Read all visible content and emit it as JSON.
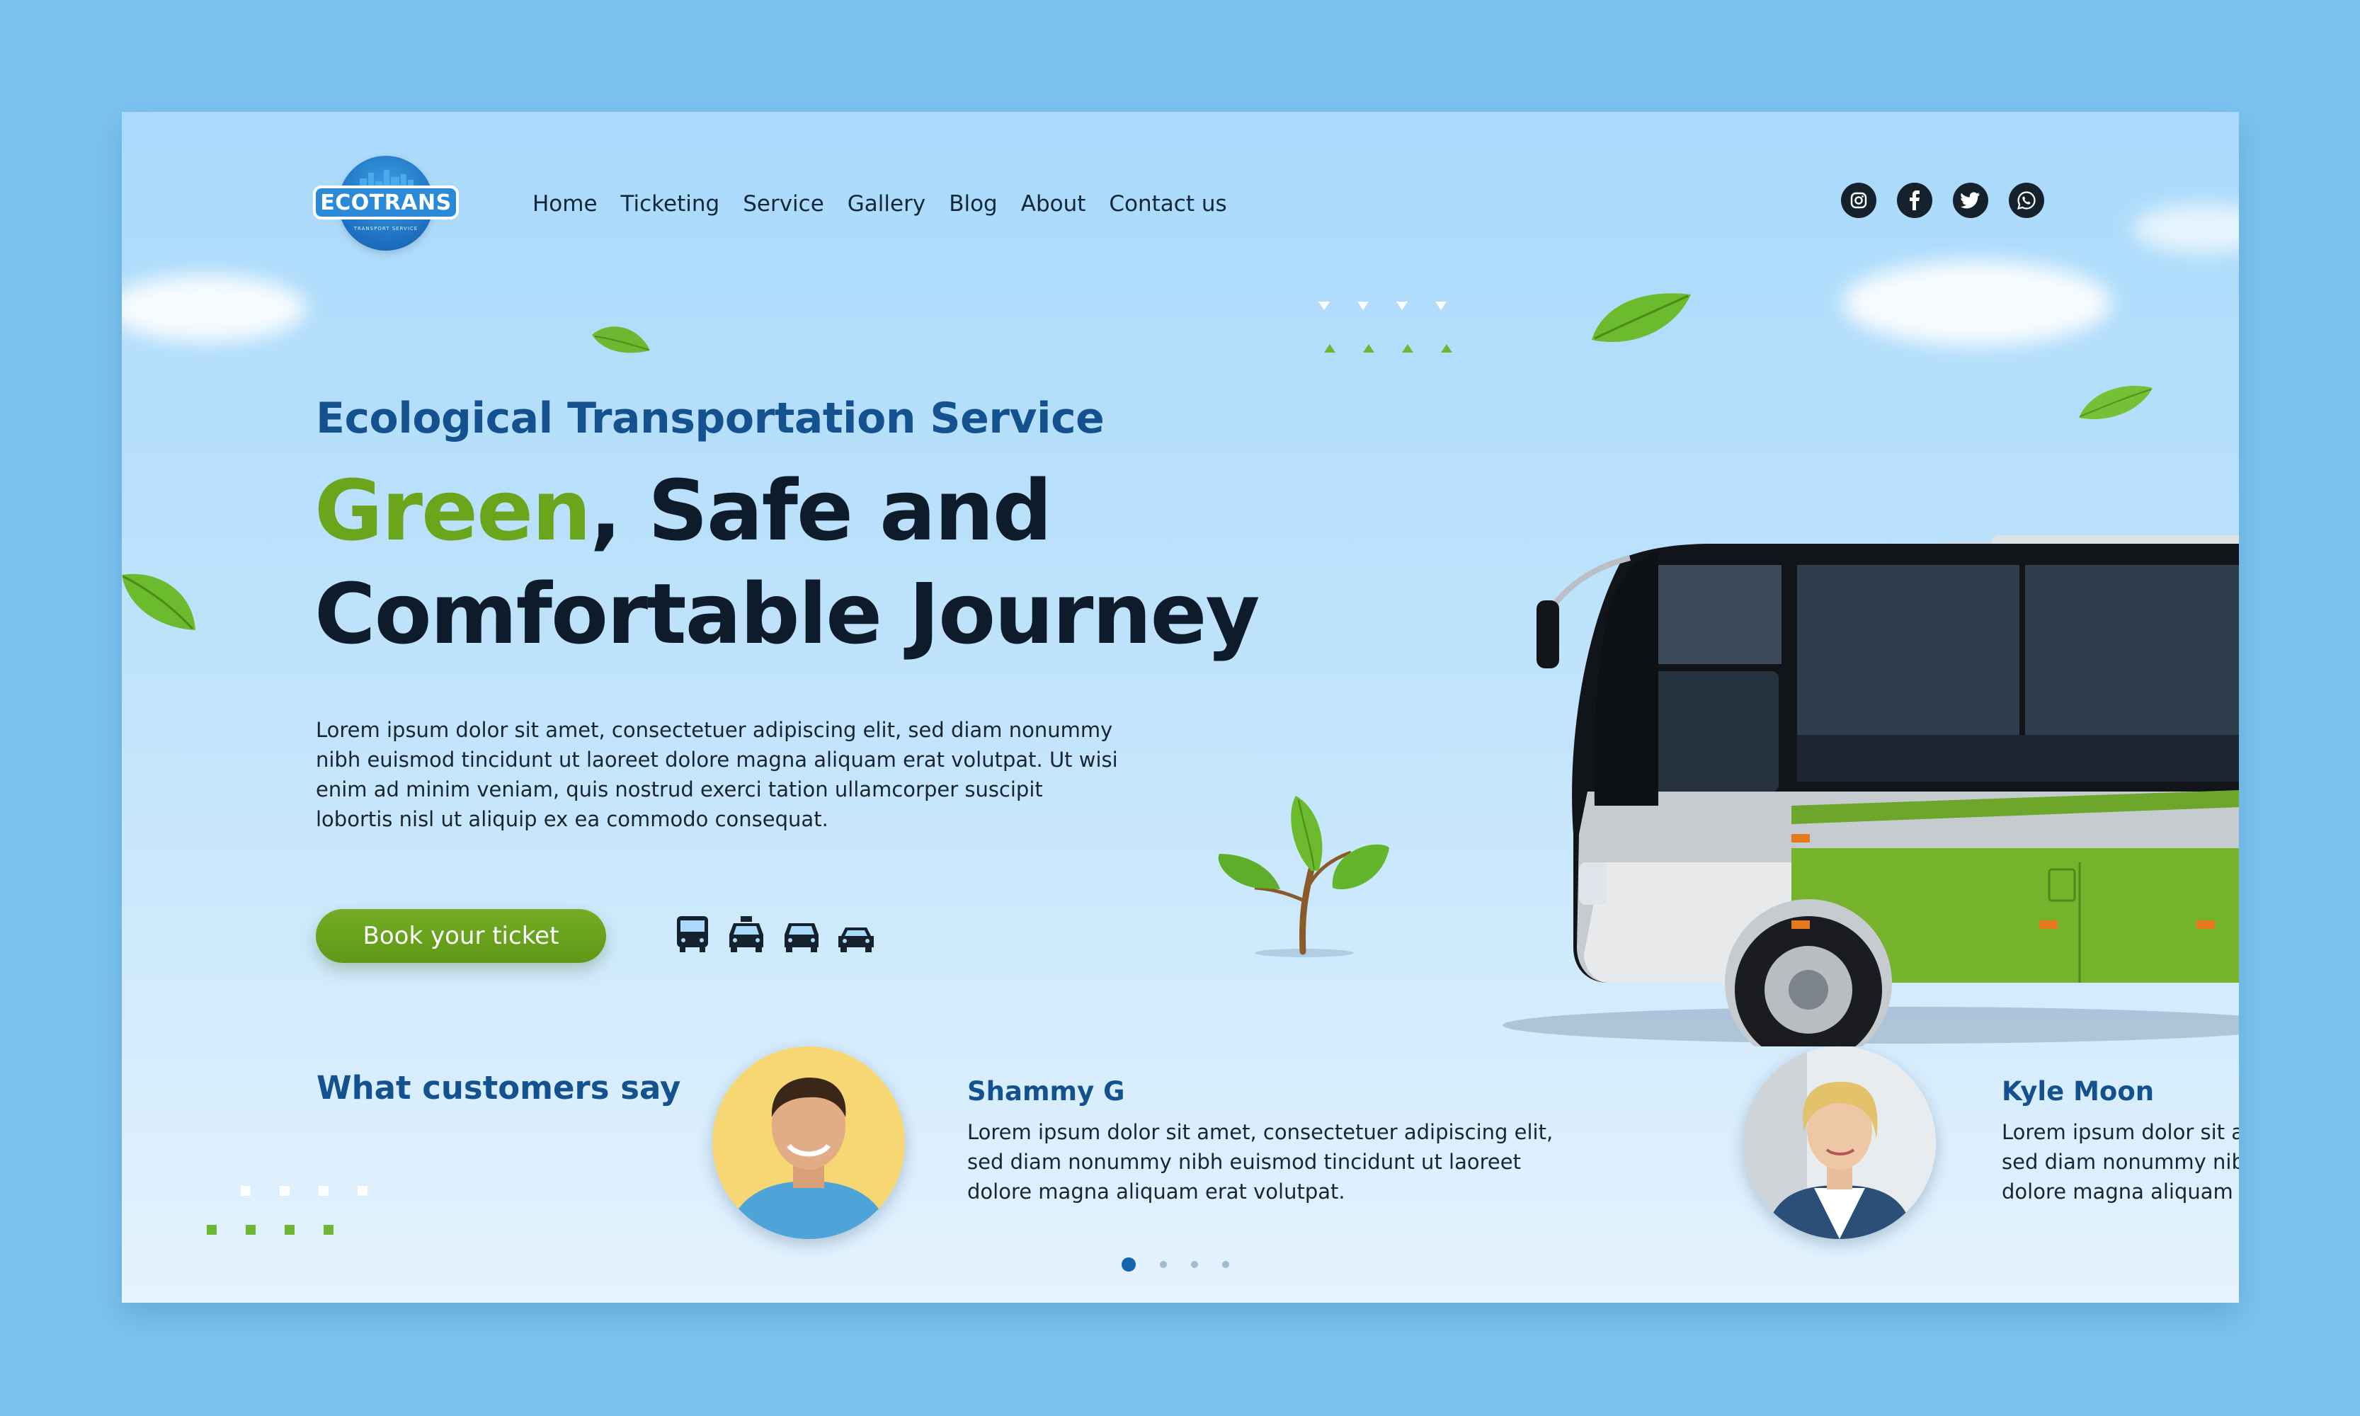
{
  "brand": {
    "name": "ECOTRANS",
    "tagline": "TRANSPORT SERVICE"
  },
  "nav": {
    "items": [
      "Home",
      "Ticketing",
      "Service",
      "Gallery",
      "Blog",
      "About",
      "Contact us"
    ]
  },
  "socials": [
    "instagram-icon",
    "facebook-icon",
    "twitter-icon",
    "whatsapp-icon"
  ],
  "hero": {
    "subtitle": "Ecological Transportation Service",
    "headline_green": "Green",
    "headline_line1_rest": ", Safe and",
    "headline_line2": "Comfortable Journey",
    "body": "Lorem ipsum dolor sit amet, consectetuer adipiscing elit, sed diam nonummy nibh euismod tincidunt ut laoreet dolore magna aliquam erat volutpat. Ut wisi enim ad minim veniam, quis nostrud exerci tation ullamcorper suscipit lobortis nisl ut aliquip ex ea commodo consequat.",
    "cta_label": "Book your ticket",
    "vehicle_icons": [
      "bus-icon",
      "taxi-icon",
      "car-icon",
      "sedan-icon"
    ]
  },
  "testimonials": {
    "heading": "What customers say",
    "items": [
      {
        "name": "Shammy G",
        "text": "Lorem ipsum dolor sit amet, consectetuer adipiscing elit, sed diam nonummy nibh euismod tincidunt ut laoreet dolore magna aliquam erat volutpat."
      },
      {
        "name": "Kyle Moon",
        "text": "Lorem ipsum dolor sit amet, consectetuer adipiscing elit, sed diam nonummy nibh euismod tincidunt ut laoreet dolore magna aliquam erat volutpat."
      }
    ],
    "pagination": {
      "total": 4,
      "active": 1
    }
  },
  "colors": {
    "accent_green": "#6aa51c",
    "brand_blue": "#13518f",
    "dark": "#0d1b2b",
    "background": "#7cc3ef"
  }
}
